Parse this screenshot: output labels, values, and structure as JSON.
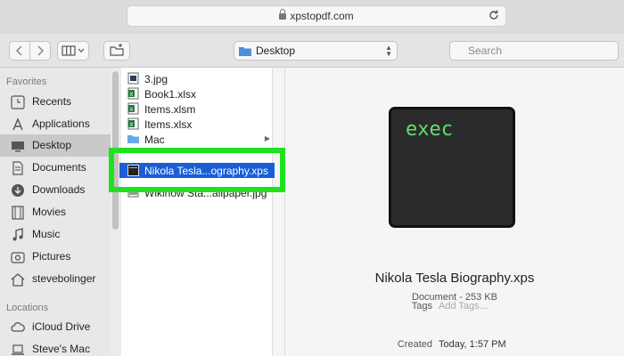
{
  "browser": {
    "url": "xpstopdf.com"
  },
  "toolbar": {
    "path": "Desktop",
    "search_placeholder": "Search"
  },
  "sidebar": {
    "favorites_header": "Favorites",
    "favorites": [
      {
        "label": "Recents",
        "icon": "clock-icon"
      },
      {
        "label": "Applications",
        "icon": "applications-icon"
      },
      {
        "label": "Desktop",
        "icon": "desktop-icon",
        "selected": true
      },
      {
        "label": "Documents",
        "icon": "documents-icon"
      },
      {
        "label": "Downloads",
        "icon": "downloads-icon"
      },
      {
        "label": "Movies",
        "icon": "movies-icon"
      },
      {
        "label": "Music",
        "icon": "music-icon"
      },
      {
        "label": "Pictures",
        "icon": "pictures-icon"
      },
      {
        "label": "stevebolinger",
        "icon": "home-icon"
      }
    ],
    "locations_header": "Locations",
    "locations": [
      {
        "label": "iCloud Drive",
        "icon": "cloud-icon"
      },
      {
        "label": "Steve's Mac",
        "icon": "laptop-icon"
      }
    ]
  },
  "files": [
    {
      "name": "3.jpg",
      "icon": "image-file-icon"
    },
    {
      "name": "Book1.xlsx",
      "icon": "excel-file-icon"
    },
    {
      "name": "Items.xlsm",
      "icon": "excel-file-icon"
    },
    {
      "name": "Items.xlsx",
      "icon": "excel-file-icon"
    },
    {
      "name": "Mac",
      "icon": "folder-icon",
      "has_children": true
    },
    {
      "name": "Nikola Tesla...ography.xps",
      "icon": "xps-file-icon",
      "selected": true
    },
    {
      "name": "Wikihow Sta...allpaper.jpg",
      "icon": "image-file-icon"
    }
  ],
  "preview": {
    "thumbnail_text": "exec",
    "name": "Nikola Tesla Biography.xps",
    "kind": "Document - 253 KB",
    "tags_label": "Tags",
    "tags_placeholder": "Add Tags...",
    "created_label": "Created",
    "created_value": "Today, 1:57 PM"
  },
  "colors": {
    "selection": "#1a5ed6",
    "highlight": "#1fe21f",
    "terminal_text": "#5de06a"
  }
}
